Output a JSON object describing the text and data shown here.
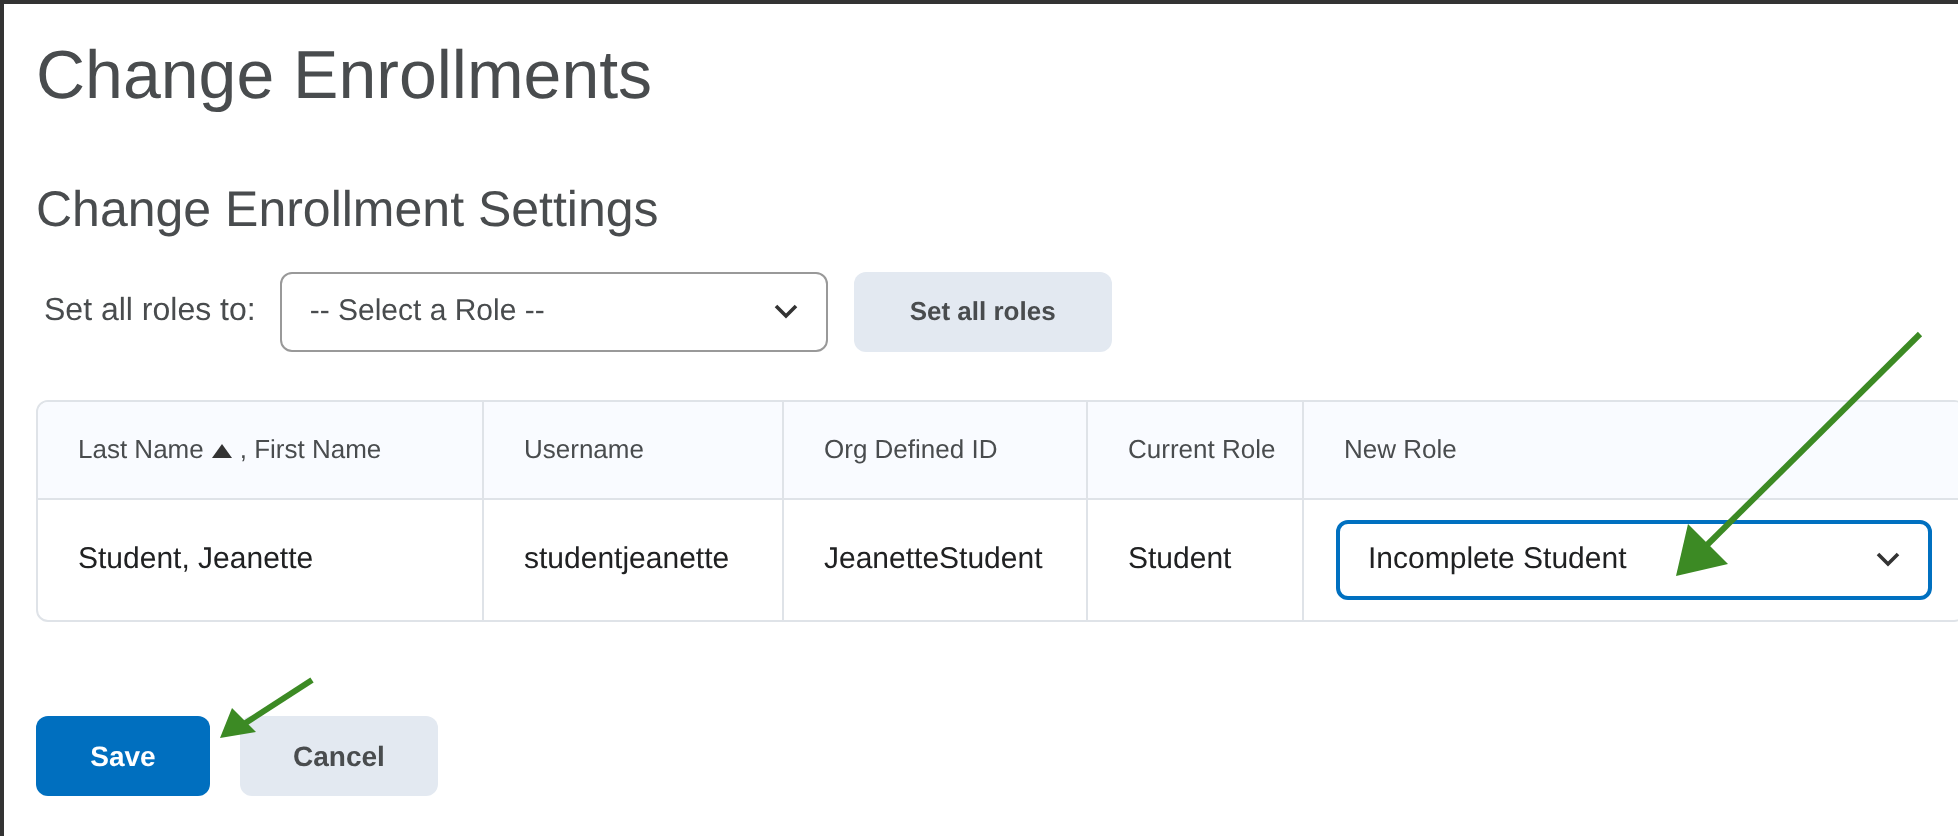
{
  "title": "Change Enrollments",
  "subtitle": "Change Enrollment Settings",
  "set_all": {
    "label": "Set all roles to:",
    "select_value": "-- Select a Role --",
    "button": "Set all roles"
  },
  "table": {
    "columns": [
      {
        "label": "Last Name",
        "sorted_ascending": true,
        "label2": ", First Name"
      },
      {
        "label": "Username"
      },
      {
        "label": "Org Defined ID"
      },
      {
        "label": "Current Role"
      },
      {
        "label": "New Role"
      }
    ],
    "rows": [
      {
        "name": "Student, Jeanette",
        "username": "studentjeanette",
        "org_id": "JeanetteStudent",
        "current_role": "Student",
        "new_role": "Incomplete Student",
        "focused": true
      }
    ]
  },
  "buttons": [
    {
      "label": "Save",
      "kind": "primary"
    },
    {
      "label": "Cancel",
      "kind": "secondary"
    }
  ]
}
